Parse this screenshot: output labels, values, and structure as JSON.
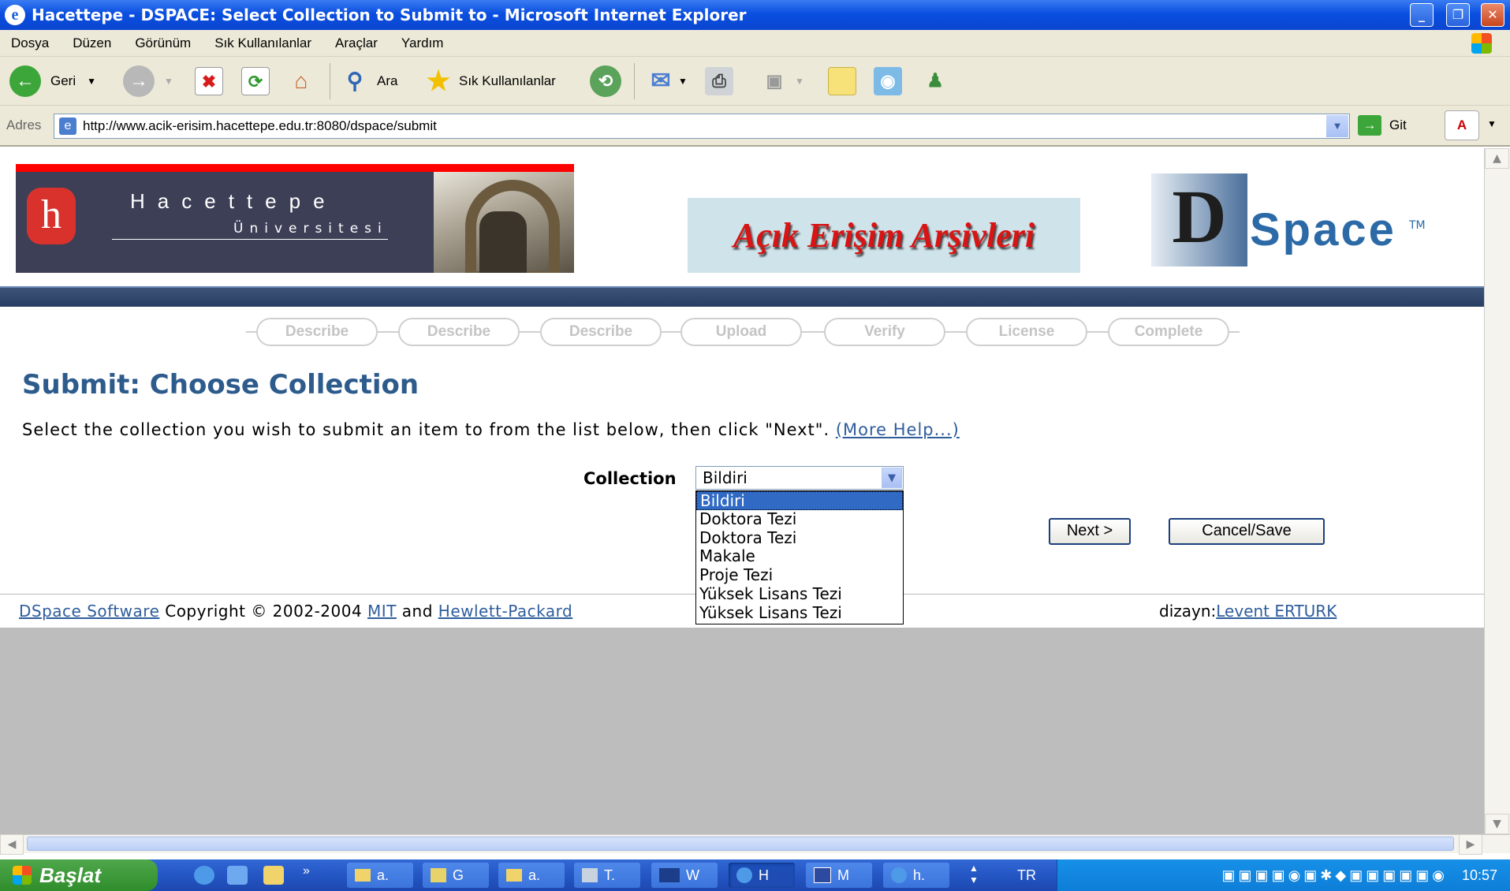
{
  "window": {
    "title": "Hacettepe - DSPACE: Select Collection to Submit to - Microsoft Internet Explorer"
  },
  "menu": [
    "Dosya",
    "Düzen",
    "Görünüm",
    "Sık Kullanılanlar",
    "Araçlar",
    "Yardım"
  ],
  "toolbar": {
    "back": "Geri",
    "search": "Ara",
    "favorites": "Sık Kullanılanlar"
  },
  "address": {
    "label": "Adres",
    "url": "http://www.acik-erisim.hacettepe.edu.tr:8080/dspace/submit",
    "go": "Git"
  },
  "banner": {
    "university_name": "Hacettepe",
    "university_sub": "Üniversitesi",
    "archive_title": "Açık Erişim Arşivleri",
    "dspace_d": "D",
    "dspace_rest": "Space",
    "dspace_tm": "TM"
  },
  "steps": [
    "Describe",
    "Describe",
    "Describe",
    "Upload",
    "Verify",
    "License",
    "Complete"
  ],
  "main": {
    "title": "Submit: Choose Collection",
    "intro": "Select the collection you wish to submit an item to from the list below, then click \"Next\".",
    "more_help": "(More Help...)",
    "collection_label": "Collection",
    "selected": "Bildiri",
    "options": [
      "Bildiri",
      "Doktora Tezi",
      "Doktora Tezi",
      "Makale",
      "Proje Tezi",
      "Yüksek Lisans Tezi",
      "Yüksek Lisans Tezi"
    ],
    "next": "Next >",
    "cancel": "Cancel/Save"
  },
  "footer": {
    "dspace": "DSpace Software",
    "copyright": "Copyright © 2002-2004",
    "mit": "MIT",
    "and": "and",
    "hp": "Hewlett-Packard",
    "design_label": "dizayn:",
    "designer": "Levent ERTURK"
  },
  "taskbar": {
    "start": "Başlat",
    "items": [
      "a.",
      "G",
      "a.",
      "T.",
      "W",
      "H",
      "M",
      "h."
    ],
    "lang": "TR",
    "clock": "10:57"
  }
}
